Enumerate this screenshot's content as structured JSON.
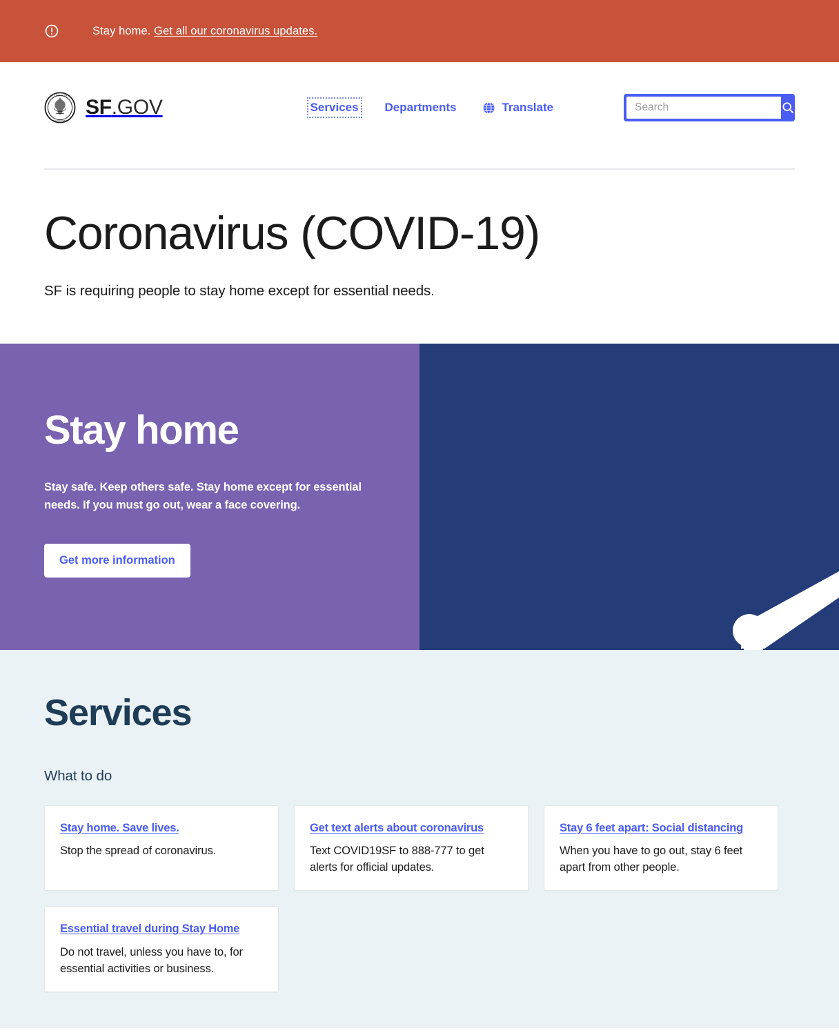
{
  "alert": {
    "icon": "exclamation-circle-icon",
    "text_prefix": "Stay home. ",
    "link_text": "Get all our coronavirus updates.",
    "background_color": "#c8523a",
    "text_color": "#ffffff"
  },
  "header": {
    "logo": {
      "icon": "sf-city-seal-icon",
      "bold_part": "SF",
      "light_part": ".GOV"
    },
    "nav": [
      {
        "label": "Services",
        "icon": null,
        "focused": true
      },
      {
        "label": "Departments",
        "icon": null,
        "focused": false
      },
      {
        "label": "Translate",
        "icon": "globe-icon",
        "focused": false
      }
    ],
    "search": {
      "placeholder": "Search",
      "value": "",
      "button_icon": "search-icon",
      "accent_color": "#4a5cf2"
    }
  },
  "page": {
    "title": "Coronavirus (COVID-19)",
    "subtitle": "SF is requiring people to stay home except for essential needs."
  },
  "hero": {
    "heading": "Stay home",
    "body": "Stay safe. Keep others safe. Stay home except for essential needs. If you must go out, wear a face covering.",
    "button_label": "Get more information",
    "left_background_color": "#7962b0",
    "right_background_color": "#243c78"
  },
  "services": {
    "heading": "Services",
    "subheading": "What to do",
    "background_color": "#eaf2f5",
    "cards": [
      {
        "link": "Stay home. Save lives.",
        "description": "Stop the spread of coronavirus."
      },
      {
        "link": "Get text alerts about coronavirus",
        "description": "Text COVID19SF to 888-777 to get alerts for official updates."
      },
      {
        "link": "Stay 6 feet apart: Social distancing",
        "description": "When you have to go out, stay 6 feet apart from other people."
      },
      {
        "link": "Essential travel during Stay Home",
        "description": "Do not travel, unless you have to, for essential activities or business."
      }
    ]
  }
}
